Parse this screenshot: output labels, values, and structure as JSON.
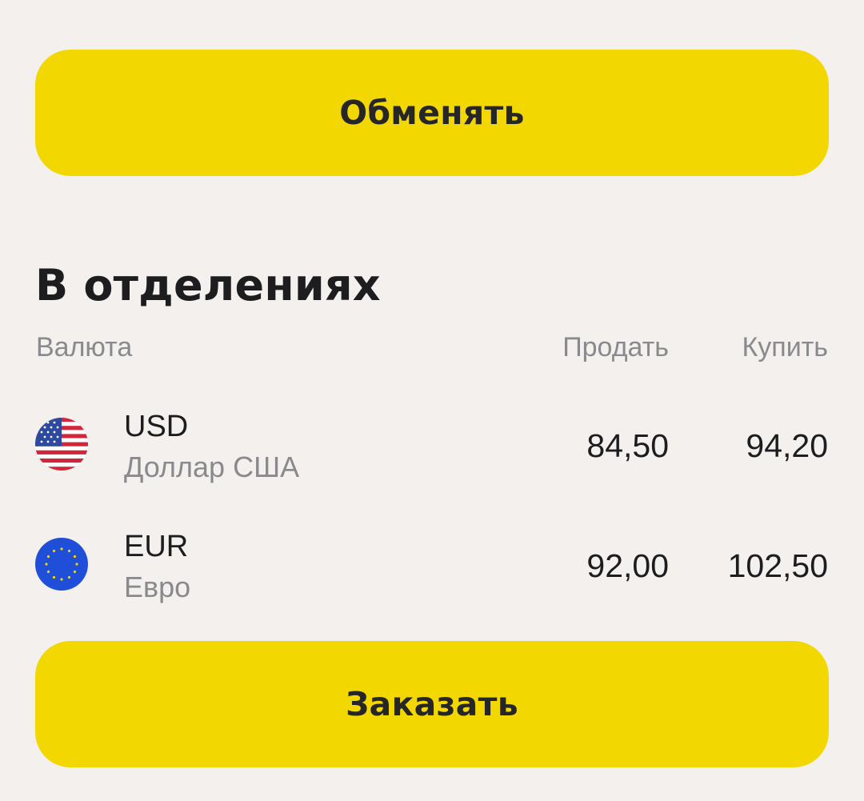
{
  "buttons": {
    "exchange_label": "Обменять",
    "order_label": "Заказать"
  },
  "section": {
    "title": "В отделениях"
  },
  "table": {
    "columns": {
      "currency": "Валюта",
      "sell": "Продать",
      "buy": "Купить"
    },
    "rows": [
      {
        "code": "USD",
        "name": "Доллар США",
        "sell": "84,50",
        "buy": "94,20",
        "icon": "us-flag-icon"
      },
      {
        "code": "EUR",
        "name": "Евро",
        "sell": "92,00",
        "buy": "102,50",
        "icon": "eu-flag-icon"
      }
    ]
  },
  "colors": {
    "accent": "#f2d800",
    "background": "#f3f0ed",
    "text_primary": "#1d1d20",
    "text_secondary": "#8a8a8e"
  }
}
